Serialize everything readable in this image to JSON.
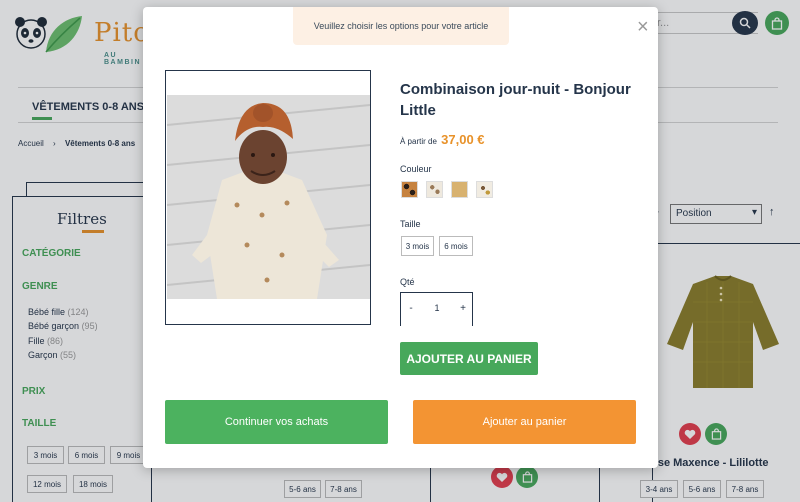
{
  "header": {
    "logo_word": "Pitch",
    "logo_tagline": "AU BAMBIN D",
    "search_placeholder": "r..."
  },
  "nav": {
    "active_item": "VÊTEMENTS 0-8 ANS"
  },
  "breadcrumb": {
    "home": "Accueil",
    "separator": "›",
    "current": "Vêtements 0-8 ans"
  },
  "filters": {
    "title": "Filtres",
    "category_heading": "CATÉGORIE",
    "genre_heading": "GENRE",
    "genre_options": [
      {
        "label": "Bébé fille",
        "count": "(124)"
      },
      {
        "label": "Bébé garçon",
        "count": "(95)"
      },
      {
        "label": "Fille",
        "count": "(86)"
      },
      {
        "label": "Garçon",
        "count": "(55)"
      }
    ],
    "price_heading": "PRIX",
    "size_heading": "TAILLE",
    "size_options": [
      "3 mois",
      "6 mois",
      "9 mois",
      "12 mois",
      "18 mois"
    ]
  },
  "sorting": {
    "label": "ar",
    "selected": "Position",
    "direction_icon": "↑"
  },
  "grid": {
    "product_name": "mise Maxence - Lililotte",
    "product_sizes": [
      "3-4 ans",
      "5-6 ans",
      "7-8 ans"
    ],
    "mid_sizes": [
      "5-6 ans",
      "7-8 ans"
    ]
  },
  "modal": {
    "notice": "Veuillez choisir les options pour votre article",
    "close_icon": "×",
    "title": "Combinaison jour-nuit - Bonjour Little",
    "price_prefix": "À partir de",
    "price": "37,00 €",
    "color_label": "Couleur",
    "size_label": "Taille",
    "sizes": [
      "3 mois",
      "6 mois"
    ],
    "qty_label": "Qté",
    "qty_minus": "-",
    "qty_value": "1",
    "qty_plus": "+",
    "add_button": "AJOUTER AU PANIER",
    "continue_button": "Continuer vos achats",
    "add_cart_button": "Ajouter au panier"
  },
  "colors": {
    "green": "#47a85b",
    "orange": "#f39433",
    "navy": "#25354a",
    "red": "#e33d4d"
  }
}
